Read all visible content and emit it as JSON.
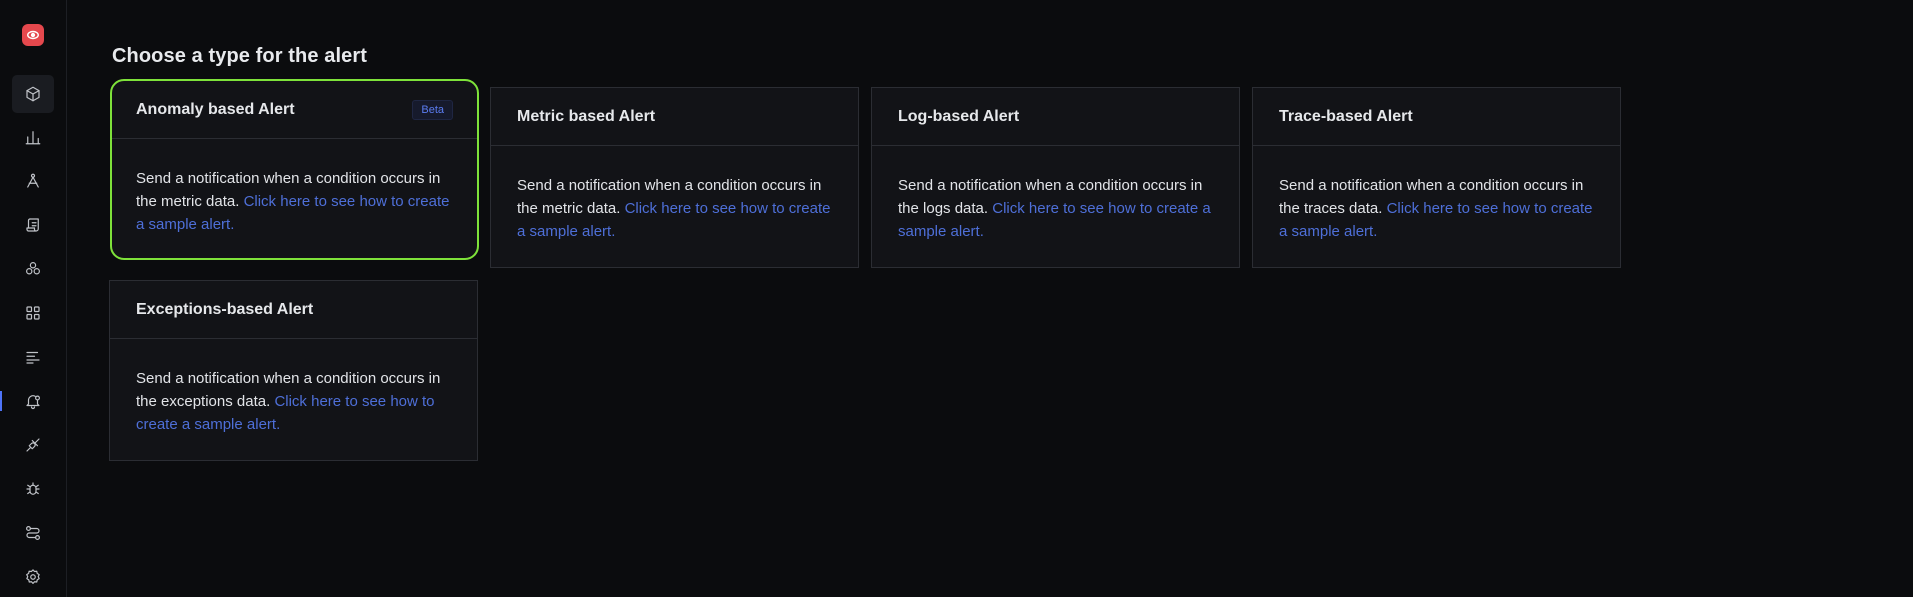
{
  "sidebar": {
    "logo_icon": "eye-logo-icon",
    "items": [
      {
        "id": "services",
        "icon": "cube-icon"
      },
      {
        "id": "dashboards",
        "icon": "bar-chart-icon"
      },
      {
        "id": "traces",
        "icon": "route-icon"
      },
      {
        "id": "logs",
        "icon": "scroll-icon"
      },
      {
        "id": "service-map",
        "icon": "boxes-icon"
      },
      {
        "id": "apps",
        "icon": "grid-icon"
      },
      {
        "id": "explorer",
        "icon": "list-icon"
      },
      {
        "id": "alerts",
        "icon": "bell-icon"
      },
      {
        "id": "integrations",
        "icon": "plug-icon"
      },
      {
        "id": "exceptions",
        "icon": "bug-icon"
      },
      {
        "id": "pipelines",
        "icon": "workflow-icon"
      },
      {
        "id": "settings",
        "icon": "gear-icon"
      }
    ],
    "active_item": "alerts"
  },
  "page": {
    "title": "Choose a type for the alert"
  },
  "cards": [
    {
      "title": "Anomaly based Alert",
      "badge": "Beta",
      "description": "Send a notification when a condition occurs in the metric data.",
      "link": "Click here to see how to create a sample alert.",
      "selected": true
    },
    {
      "title": "Metric based Alert",
      "badge": "",
      "description": "Send a notification when a condition occurs in the metric data.",
      "link": "Click here to see how to create a sample alert.",
      "selected": false
    },
    {
      "title": "Log-based Alert",
      "badge": "",
      "description": "Send a notification when a condition occurs in the logs data.",
      "link": "Click here to see how to create a sample alert.",
      "selected": false
    },
    {
      "title": "Trace-based Alert",
      "badge": "",
      "description": "Send a notification when a condition occurs in the traces data.",
      "link": "Click here to see how to create a sample alert.",
      "selected": false
    },
    {
      "title": "Exceptions-based Alert",
      "badge": "",
      "description": "Send a notification when a condition occurs in the exceptions data.",
      "link": "Click here to see how to create a sample alert.",
      "selected": false
    }
  ],
  "colors": {
    "accent": "#4e6fd8",
    "selection": "#7ee23a",
    "logo": "#e5484d"
  }
}
